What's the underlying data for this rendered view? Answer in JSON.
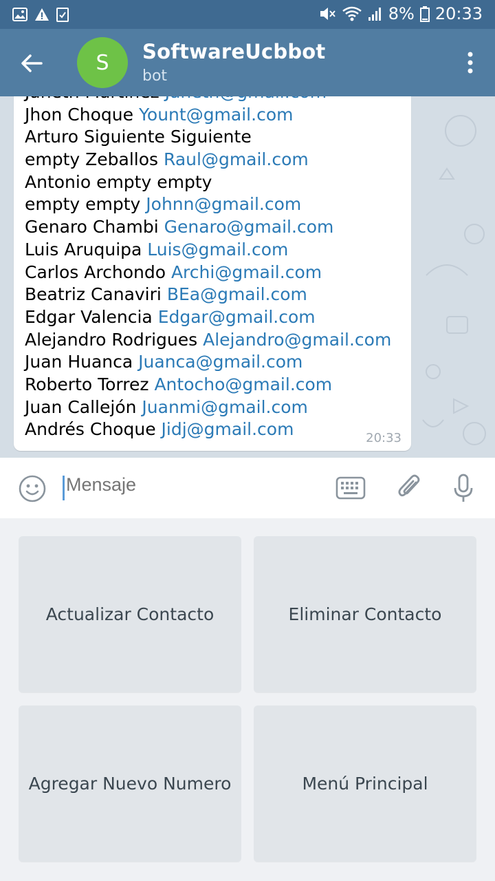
{
  "status_bar": {
    "battery": "8%",
    "time": "20:33"
  },
  "header": {
    "avatar_letter": "S",
    "title": "SoftwareUcbbot",
    "subtitle": "bot"
  },
  "message": {
    "lines": [
      {
        "name": "Janeth Martinez ",
        "email": "Janeth@gmail.com"
      },
      {
        "name": "Jhon Choque ",
        "email": "Yount@gmail.com"
      },
      {
        "name": "Arturo Siguiente Siguiente",
        "email": ""
      },
      {
        "name": "empty Zeballos ",
        "email": "Raul@gmail.com"
      },
      {
        "name": "Antonio empty empty",
        "email": ""
      },
      {
        "name": "empty empty ",
        "email": "Johnn@gmail.com"
      },
      {
        "name": "Genaro Chambi ",
        "email": "Genaro@gmail.com"
      },
      {
        "name": "Luis Aruquipa ",
        "email": "Luis@gmail.com"
      },
      {
        "name": "Carlos Archondo ",
        "email": "Archi@gmail.com"
      },
      {
        "name": "Beatriz Canaviri ",
        "email": "BEa@gmail.com"
      },
      {
        "name": "Edgar Valencia ",
        "email": "Edgar@gmail.com"
      },
      {
        "name": "Alejandro Rodrigues ",
        "email": "Alejandro@gmail.com"
      },
      {
        "name": "Juan Huanca ",
        "email": "Juanca@gmail.com"
      },
      {
        "name": "Roberto Torrez ",
        "email": "Antocho@gmail.com"
      },
      {
        "name": "Juan Callejón ",
        "email": "Juanmi@gmail.com"
      },
      {
        "name": "Andrés Choque ",
        "email": "Jidj@gmail.com"
      }
    ],
    "time": "20:33"
  },
  "input": {
    "placeholder": "Mensaje"
  },
  "keyboard": {
    "buttons": [
      "Actualizar Contacto",
      "Eliminar Contacto",
      "Agregar Nuevo Numero",
      "Menú Principal"
    ]
  },
  "colors": {
    "header": "#517da2",
    "status_bar": "#3f6a91",
    "avatar": "#6ec247",
    "link": "#2b7ab6"
  },
  "icons": [
    "image-icon",
    "warning-icon",
    "checklist-icon",
    "mute-icon",
    "wifi-icon",
    "signal-icon",
    "battery-icon",
    "back-arrow-icon",
    "more-vert-icon",
    "emoji-icon",
    "keyboard-icon",
    "attach-icon",
    "mic-icon"
  ]
}
